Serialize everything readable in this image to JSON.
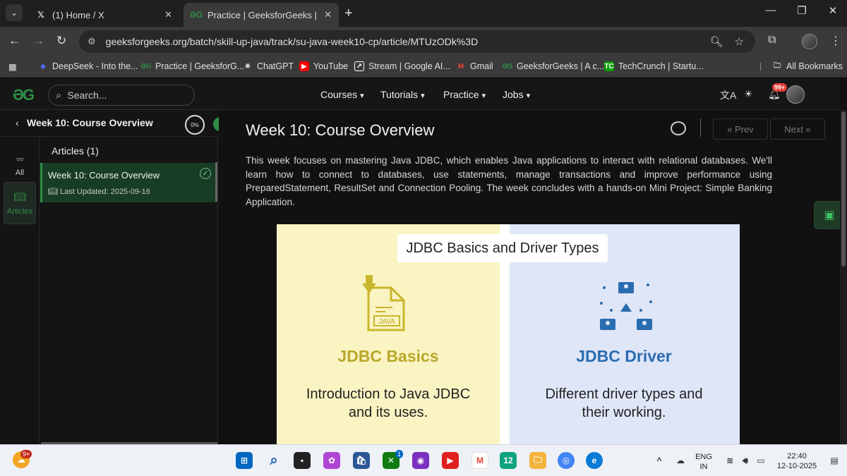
{
  "browser": {
    "tabs": [
      {
        "title": "(1) Home / X",
        "icon": "x-logo-icon"
      },
      {
        "title": "Practice | GeeksforGeeks | A co",
        "icon": "gfg-logo-icon"
      }
    ],
    "url": "geeksforgeeks.org/batch/skill-up-java/track/su-java-week10-cp/article/MTUzODk%3D",
    "bookmarks": [
      {
        "label": "DeepSeek - Into the...",
        "color": "#4d6bfe"
      },
      {
        "label": "Practice | GeeksforG...",
        "color": "#2f8d46"
      },
      {
        "label": "ChatGPT",
        "color": "#cccccc"
      },
      {
        "label": "YouTube",
        "color": "#ff0000"
      },
      {
        "label": "Stream | Google AI...",
        "color": "#ffffff"
      },
      {
        "label": "Gmail",
        "color": "#ea4335"
      },
      {
        "label": "GeeksforGeeks | A c...",
        "color": "#2f8d46"
      },
      {
        "label": "TechCrunch | Startu...",
        "color": "#0a9e01"
      }
    ],
    "all_bookmarks": "All Bookmarks"
  },
  "header": {
    "search_placeholder": "Search...",
    "menu": [
      "Courses",
      "Tutorials",
      "Practice",
      "Jobs"
    ],
    "notification_count": "99+"
  },
  "sidebar": {
    "title": "Week 10: Course Overview",
    "progress": "0%",
    "rail": [
      {
        "label": "All"
      },
      {
        "label": "Articles"
      }
    ],
    "articles_heading": "Articles (1)",
    "article": {
      "title": "Week 10: Course Overview",
      "meta": "Last Updated: 2025-09-16"
    }
  },
  "main": {
    "title": "Week 10: Course Overview",
    "prev_label": "Prev",
    "next_label": "Next",
    "description": "This week focuses on mastering Java JDBC, which enables Java applications to interact with relational databases. We'll learn how to connect to databases, use statements, manage transactions and improve performance using PreparedStatement, ResultSet and Connection Pooling. The week concludes with a hands-on Mini Project: Simple Banking Application.",
    "infographic": {
      "title": "JDBC Basics and Driver Types",
      "file_label": "JAVA",
      "left": {
        "heading": "JDBC Basics",
        "text_line1": "Introduction to Java JDBC",
        "text_line2": "and its uses.",
        "color": "#b9a82a"
      },
      "right": {
        "heading": "JDBC Driver",
        "text_line1": "Different driver types and",
        "text_line2": "their working.",
        "color": "#2a6cb0"
      }
    }
  },
  "taskbar": {
    "widget_badge": "9+",
    "store_badge": "1",
    "language_line1": "ENG",
    "language_line2": "IN",
    "time": "22:40",
    "date": "12-10-2025"
  },
  "colors": {
    "gfg_green": "#2f8d46",
    "badge_red": "#e53935"
  }
}
